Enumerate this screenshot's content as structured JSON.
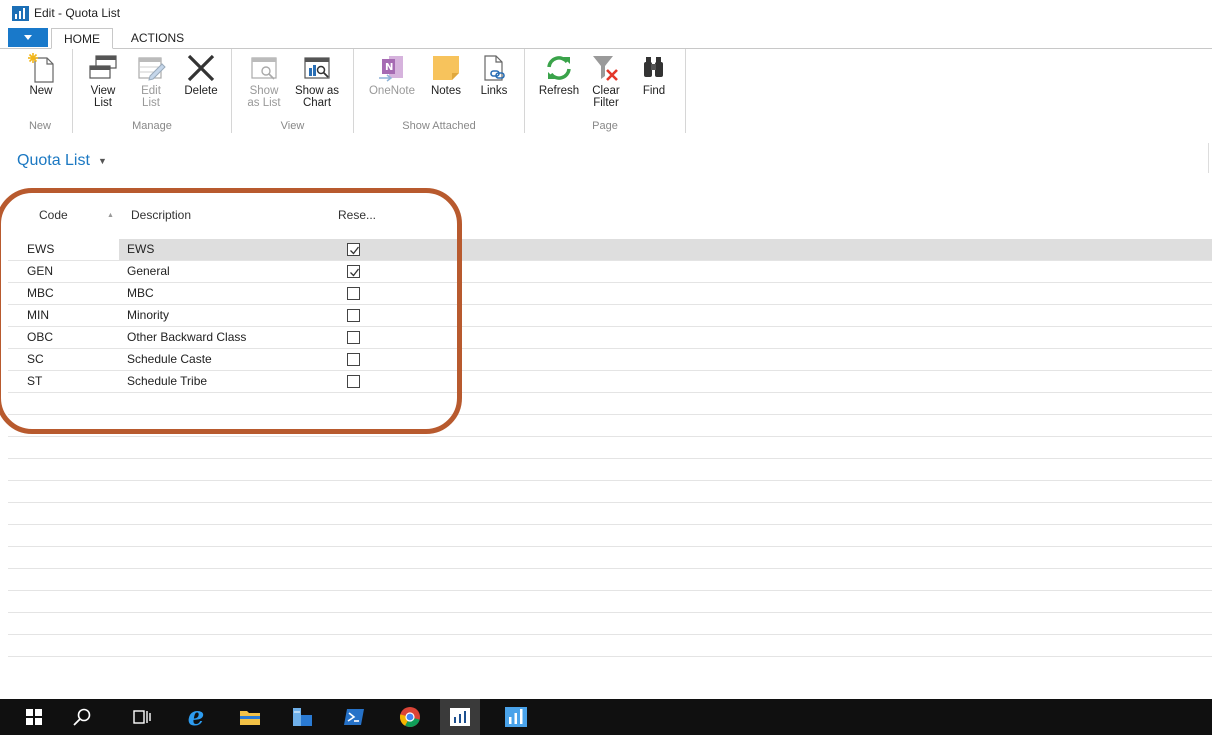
{
  "window": {
    "title": "Edit - Quota List"
  },
  "tabs": [
    {
      "label": "HOME"
    },
    {
      "label": "ACTIONS"
    }
  ],
  "ribbon": {
    "groups": {
      "new": "New",
      "manage": "Manage",
      "view": "View",
      "show_attached": "Show Attached",
      "page": "Page"
    },
    "buttons": {
      "new": "New",
      "view_list_1": "View",
      "view_list_2": "List",
      "edit_list_1": "Edit",
      "edit_list_2": "List",
      "delete": "Delete",
      "show_as_list_1": "Show",
      "show_as_list_2": "as List",
      "show_as_chart_1": "Show as",
      "show_as_chart_2": "Chart",
      "onenote": "OneNote",
      "notes": "Notes",
      "links": "Links",
      "refresh": "Refresh",
      "clear_filter_1": "Clear",
      "clear_filter_2": "Filter",
      "find": "Find"
    }
  },
  "page": {
    "title": "Quota List"
  },
  "columns": {
    "code": "Code",
    "description": "Description",
    "reserved": "Rese..."
  },
  "rows": [
    {
      "code": "EWS",
      "description": "EWS",
      "reserved": true
    },
    {
      "code": "GEN",
      "description": "General",
      "reserved": true
    },
    {
      "code": "MBC",
      "description": "MBC",
      "reserved": false
    },
    {
      "code": "MIN",
      "description": "Minority",
      "reserved": false
    },
    {
      "code": "OBC",
      "description": "Other Backward Class",
      "reserved": false
    },
    {
      "code": "SC",
      "description": "Schedule Caste",
      "reserved": false
    },
    {
      "code": "ST",
      "description": "Schedule Tribe",
      "reserved": false
    }
  ],
  "colors": {
    "accent": "#1979ca",
    "title": "#1b78c2",
    "highlight": "#b85a2e"
  },
  "taskbar": [
    "windows-start-icon",
    "search-icon",
    "task-view-icon",
    "internet-explorer-icon",
    "file-explorer-icon",
    "server-manager-icon",
    "powershell-icon",
    "chrome-icon",
    "dynamics-nav-icon",
    "dynamics-nav-icon"
  ]
}
